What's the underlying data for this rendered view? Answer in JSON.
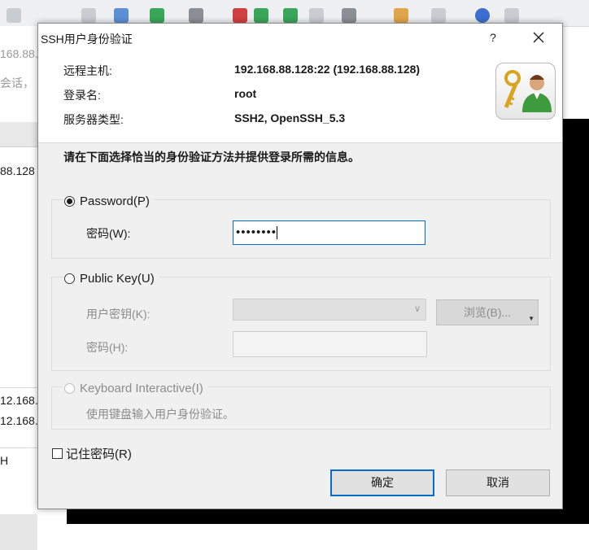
{
  "background": {
    "left_rows": [
      "168.88.",
      "会话，",
      "88.128",
      "12.168.",
      "12.168.",
      "",
      "H"
    ]
  },
  "dialog": {
    "title": "SSH用户身份验证",
    "help_label": "?",
    "info": {
      "remote_host_label": "远程主机:",
      "remote_host_value": "192.168.88.128:22 (192.168.88.128)",
      "login_label": "登录名:",
      "login_value": "root",
      "server_type_label": "服务器类型:",
      "server_type_value": "SSH2, OpenSSH_5.3"
    },
    "instruction": "请在下面选择恰当的身份验证方法并提供登录所需的信息。",
    "password_group": {
      "label": "Password(P)",
      "field_label": "密码(W):",
      "value": "••••••••"
    },
    "publickey_group": {
      "label": "Public Key(U)",
      "user_key_label": "用户密钥(K):",
      "browse_label": "浏览(B)...",
      "passphrase_label": "密码(H):"
    },
    "keyboard_group": {
      "label": "Keyboard Interactive(I)",
      "description": "使用键盘输入用户身份验证。"
    },
    "remember_password_label": "记住密码(R)",
    "ok_label": "确定",
    "cancel_label": "取消"
  },
  "colors": {
    "accent": "#0a6cc9",
    "dialog_bg": "#f0f0f0",
    "disabled_text": "#8c8c8c"
  },
  "icons": {
    "close": "close-icon",
    "user_key": "user-key-icon",
    "dropdown": "chevron-down-icon"
  }
}
